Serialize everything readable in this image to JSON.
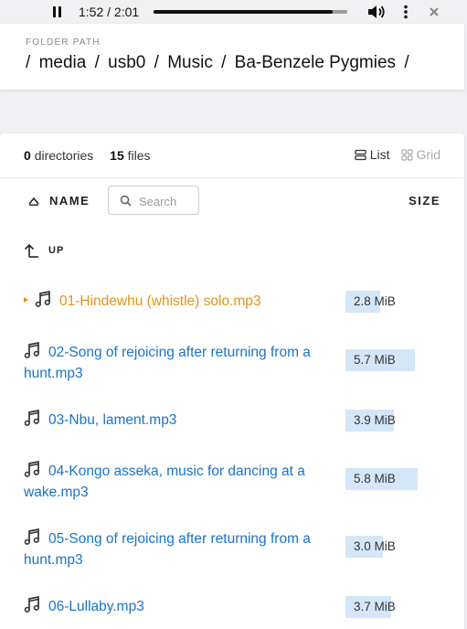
{
  "player": {
    "time": "1:52 / 2:01",
    "progress": 0.926
  },
  "header": {
    "folder_label": "FOLDER PATH",
    "path": [
      "media",
      "usb0",
      "Music",
      "Ba-Benzele Pygmies"
    ]
  },
  "summary": {
    "dir_count": "0",
    "dir_label": "directories",
    "file_count": "15",
    "file_label": "files"
  },
  "view": {
    "list_label": "List",
    "grid_label": "Grid"
  },
  "columns": {
    "name": "NAME",
    "size": "SIZE",
    "search_placeholder": "Search"
  },
  "up_label": "UP",
  "files": [
    {
      "name": "01-Hindewhu (whistle) solo.mp3",
      "size": "2.8 MiB",
      "size_fraction": 0.38,
      "playing": true
    },
    {
      "name": "02-Song of rejoicing after returning from a hunt.mp3",
      "size": "5.7 MiB",
      "size_fraction": 0.76
    },
    {
      "name": "03-Nbu, lament.mp3",
      "size": "3.9 MiB",
      "size_fraction": 0.53
    },
    {
      "name": "04-Kongo asseka, music for dancing at a wake.mp3",
      "size": "5.8 MiB",
      "size_fraction": 0.79
    },
    {
      "name": "05-Song of rejoicing after returning from a hunt.mp3",
      "size": "3.0 MiB",
      "size_fraction": 0.41
    },
    {
      "name": "06-Lullaby.mp3",
      "size": "3.7 MiB",
      "size_fraction": 0.5
    }
  ],
  "colors": {
    "link": "#1a73c7",
    "playing": "#e39316",
    "size_bar": "#d4e7f8"
  }
}
